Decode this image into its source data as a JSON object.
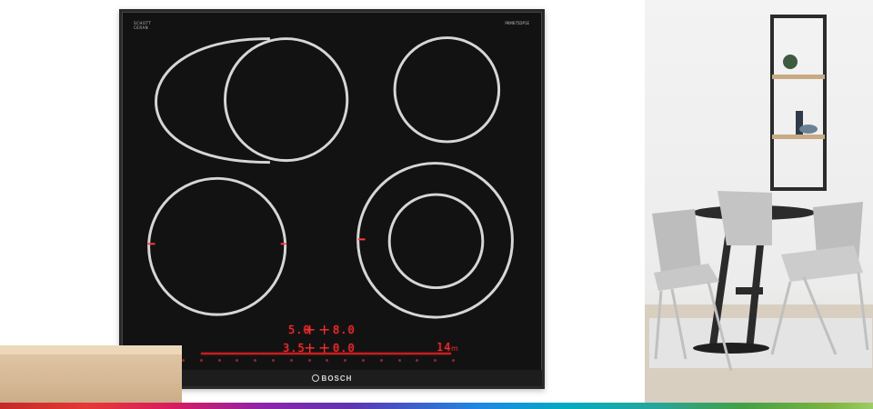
{
  "cooktop": {
    "badge_small_line1": "SCHOTT",
    "badge_small_line2": "CERAN",
    "badge_small_line3": "",
    "badge_right": "PKM675DP1E",
    "display": {
      "top_left": "5.0",
      "top_right": "8.0",
      "bottom_left": "3.5",
      "bottom_right": "0.0",
      "timer": "14",
      "timer_unit": "m"
    },
    "brand": "BOSCH"
  }
}
